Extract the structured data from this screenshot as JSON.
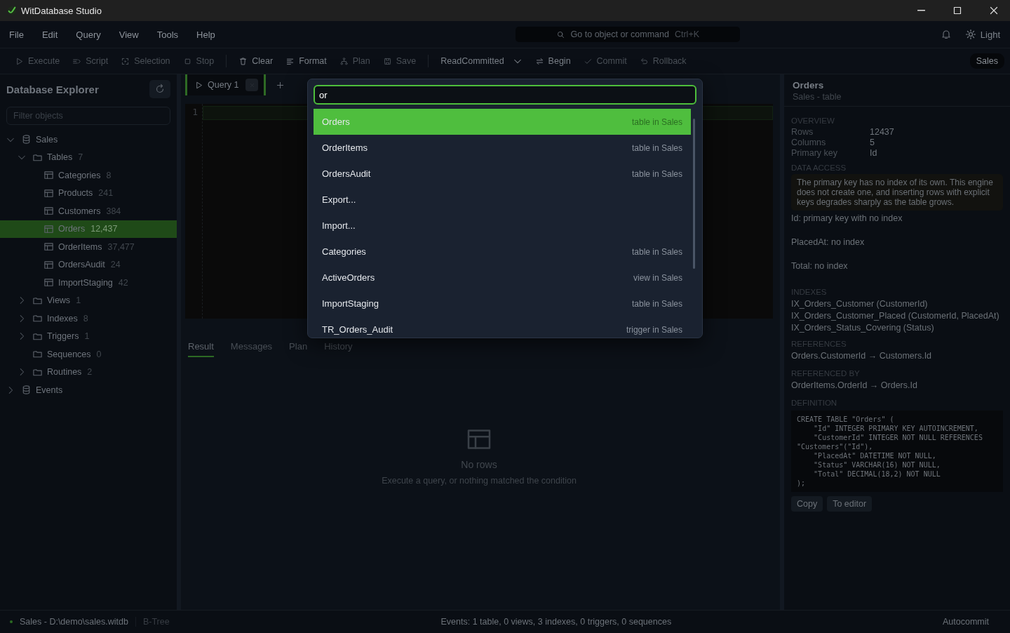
{
  "window": {
    "title": "WitDatabase Studio"
  },
  "menu": [
    "File",
    "Edit",
    "Query",
    "View",
    "Tools",
    "Help"
  ],
  "command_search": {
    "placeholder": "Go to object or command",
    "shortcut": "Ctrl+K"
  },
  "theme_toggle": {
    "label": "Light"
  },
  "toolbar": [
    {
      "kind": "button",
      "label": "Execute",
      "disabled": true
    },
    {
      "kind": "button",
      "label": "Script",
      "disabled": true
    },
    {
      "kind": "button",
      "label": "Selection",
      "disabled": true
    },
    {
      "kind": "button",
      "label": "Stop",
      "disabled": true
    },
    {
      "kind": "separator"
    },
    {
      "kind": "button",
      "label": "Clear",
      "disabled": false
    },
    {
      "kind": "button",
      "label": "Format",
      "disabled": false
    },
    {
      "kind": "button",
      "label": "Plan",
      "disabled": true
    },
    {
      "kind": "button",
      "label": "Save",
      "disabled": true
    },
    {
      "kind": "separator"
    },
    {
      "kind": "dropdown",
      "label": "ReadCommitted",
      "disabled": false
    },
    {
      "kind": "button",
      "label": "Begin",
      "disabled": false
    },
    {
      "kind": "button",
      "label": "Commit",
      "disabled": true
    },
    {
      "kind": "button",
      "label": "Rollback",
      "disabled": true
    }
  ],
  "database_badge": "Sales",
  "explorer": {
    "title": "Database Explorer",
    "filter_placeholder": "Filter objects",
    "tree": [
      {
        "kind": "database",
        "label": "Sales",
        "expanded": true,
        "selected": false,
        "children": [
          {
            "kind": "folder",
            "label": "Tables",
            "count": "7",
            "expanded": true,
            "selected": false,
            "children": [
              {
                "kind": "table",
                "label": "Categories",
                "count": "8",
                "selected": false
              },
              {
                "kind": "table",
                "label": "Products",
                "count": "241",
                "selected": false
              },
              {
                "kind": "table",
                "label": "Customers",
                "count": "384",
                "selected": false
              },
              {
                "kind": "table",
                "label": "Orders",
                "count": "12,437",
                "selected": true
              },
              {
                "kind": "table",
                "label": "OrderItems",
                "count": "37,477",
                "selected": false
              },
              {
                "kind": "table",
                "label": "OrdersAudit",
                "count": "24",
                "selected": false
              },
              {
                "kind": "table",
                "label": "ImportStaging",
                "count": "42",
                "selected": false
              }
            ]
          },
          {
            "kind": "folder",
            "label": "Views",
            "count": "1",
            "expanded": false,
            "selected": false
          },
          {
            "kind": "folder",
            "label": "Indexes",
            "count": "8",
            "expanded": false,
            "selected": false
          },
          {
            "kind": "folder",
            "label": "Triggers",
            "count": "1",
            "expanded": false,
            "selected": false
          },
          {
            "kind": "folder",
            "label": "Sequences",
            "count": "0",
            "selected": false
          },
          {
            "kind": "folder",
            "label": "Routines",
            "count": "2",
            "expanded": false,
            "selected": false
          }
        ]
      },
      {
        "kind": "database",
        "label": "Events",
        "expanded": false,
        "selected": false
      }
    ]
  },
  "editor": {
    "tabs": [
      {
        "label": "Query 1",
        "selected": true
      }
    ],
    "line_numbers": [
      "1"
    ]
  },
  "result_tabs": [
    {
      "label": "Result",
      "selected": true
    },
    {
      "label": "Messages",
      "selected": false
    },
    {
      "label": "Plan",
      "selected": false
    },
    {
      "label": "History",
      "selected": false
    }
  ],
  "empty_state": {
    "title": "No rows",
    "hint": "Execute a query, or nothing matched the condition"
  },
  "quick_open": {
    "query": "or",
    "results": [
      {
        "label": "Orders",
        "detail": "table in Sales",
        "selected": true
      },
      {
        "label": "OrderItems",
        "detail": "table in Sales",
        "selected": false
      },
      {
        "label": "OrdersAudit",
        "detail": "table in Sales",
        "selected": false
      },
      {
        "label": "Export...",
        "selected": false
      },
      {
        "label": "Import...",
        "selected": false
      },
      {
        "label": "Categories",
        "detail": "table in Sales",
        "selected": false
      },
      {
        "label": "ActiveOrders",
        "detail": "view in Sales",
        "selected": false
      },
      {
        "label": "ImportStaging",
        "detail": "table in Sales",
        "selected": false
      },
      {
        "label": "TR_Orders_Audit",
        "detail": "trigger in Sales",
        "selected": false
      }
    ]
  },
  "details": {
    "title": "Orders",
    "subtitle": "Sales - table",
    "overview_heading": "OVERVIEW",
    "overview": [
      {
        "label": "Rows",
        "value": "12437"
      },
      {
        "label": "Columns",
        "value": "5"
      },
      {
        "label": "Primary key",
        "value": "Id"
      }
    ],
    "data_access_heading": "DATA ACCESS",
    "warning": "The primary key has no index of its own. This engine does not create one, and inserting rows with explicit keys degrades sharply as the table grows.",
    "access_notes": [
      "Id: primary key with no index",
      "PlacedAt: no index",
      "Total: no index"
    ],
    "indexes_heading": "INDEXES",
    "indexes": [
      "IX_Orders_Customer (CustomerId)",
      "IX_Orders_Customer_Placed (CustomerId, PlacedAt)",
      "IX_Orders_Status_Covering (Status)"
    ],
    "references_heading": "REFERENCES",
    "references": [
      "Orders.CustomerId → Customers.Id"
    ],
    "referenced_by_heading": "REFERENCED BY",
    "referenced_by": [
      "OrderItems.OrderId → Orders.Id"
    ],
    "definition_heading": "DEFINITION",
    "definition": "CREATE TABLE \"Orders\" (\n    \"Id\" INTEGER PRIMARY KEY AUTOINCREMENT,\n    \"CustomerId\" INTEGER NOT NULL REFERENCES \"Customers\"(\"Id\"),\n    \"PlacedAt\" DATETIME NOT NULL,\n    \"Status\" VARCHAR(16) NOT NULL,\n    \"Total\" DECIMAL(18,2) NOT NULL\n);",
    "buttons": [
      "Copy",
      "To editor"
    ]
  },
  "status_bar": {
    "connection": "Sales - D:\\demo\\sales.witdb",
    "engine": "B-Tree",
    "summary": "Events: 1 table, 0 views, 3 indexes, 0 triggers, 0 sequences",
    "mode": "Autocommit"
  }
}
